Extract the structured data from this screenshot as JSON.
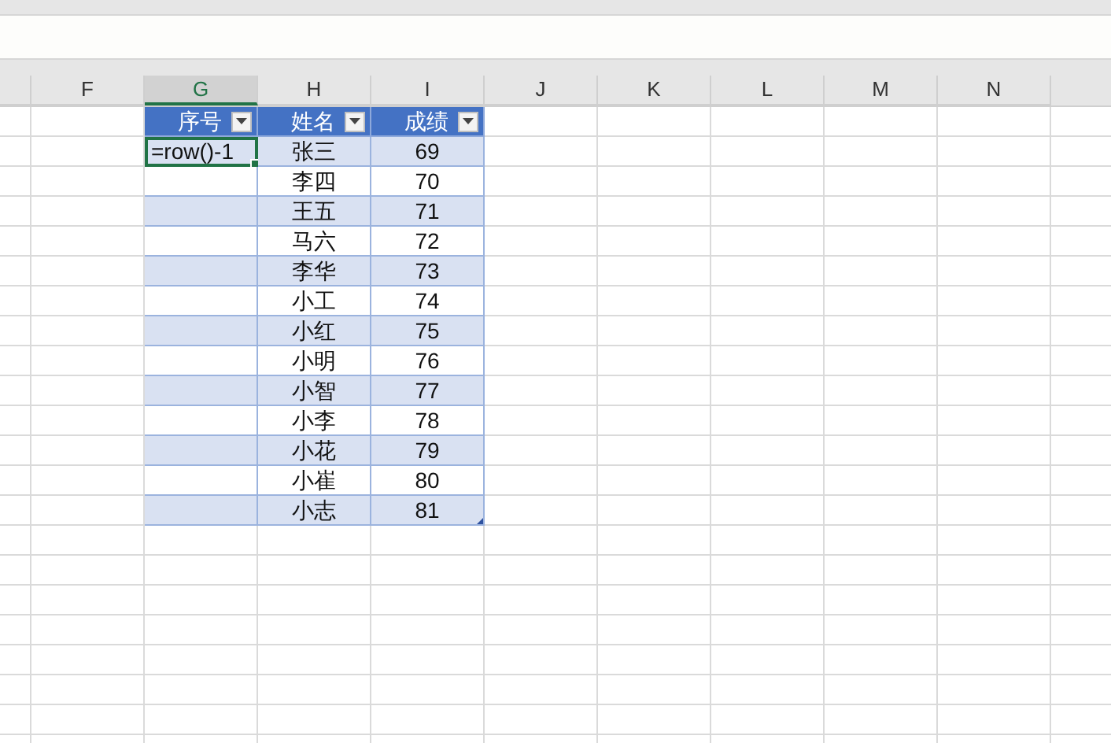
{
  "columns": [
    {
      "label": "F",
      "selected": false
    },
    {
      "label": "G",
      "selected": true
    },
    {
      "label": "H",
      "selected": false
    },
    {
      "label": "I",
      "selected": false
    },
    {
      "label": "J",
      "selected": false
    },
    {
      "label": "K",
      "selected": false
    },
    {
      "label": "L",
      "selected": false
    },
    {
      "label": "M",
      "selected": false
    },
    {
      "label": "N",
      "selected": false
    }
  ],
  "table": {
    "headers": [
      {
        "label": "序号"
      },
      {
        "label": "姓名"
      },
      {
        "label": "成绩"
      }
    ],
    "editing_cell": "=row()-1",
    "rows": [
      {
        "name": "张三",
        "score": "69"
      },
      {
        "name": "李四",
        "score": "70"
      },
      {
        "name": "王五",
        "score": "71"
      },
      {
        "name": "马六",
        "score": "72"
      },
      {
        "name": "李华",
        "score": "73"
      },
      {
        "name": "小工",
        "score": "74"
      },
      {
        "name": "小红",
        "score": "75"
      },
      {
        "name": "小明",
        "score": "76"
      },
      {
        "name": "小智",
        "score": "77"
      },
      {
        "name": "小李",
        "score": "78"
      },
      {
        "name": "小花",
        "score": "79"
      },
      {
        "name": "小崔",
        "score": "80"
      },
      {
        "name": "小志",
        "score": "81"
      }
    ]
  }
}
